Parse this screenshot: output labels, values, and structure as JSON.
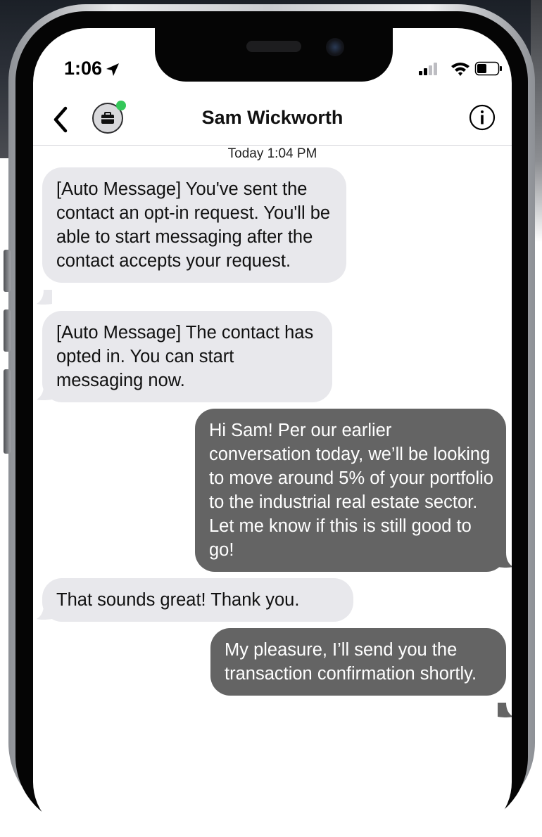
{
  "status_bar": {
    "time": "1:06"
  },
  "header": {
    "title": "Sam Wickworth",
    "back_icon": "chevron-left-icon",
    "avatar_icon": "briefcase-icon",
    "info_icon": "info-circle-icon",
    "presence_color": "#34c759"
  },
  "thread": {
    "timestamp": "Today 1:04 PM",
    "messages": [
      {
        "direction": "incoming",
        "text": "[Auto Message] You've sent the contact an opt-in request. You'll be able to start messaging after the contact accepts your request."
      },
      {
        "direction": "incoming",
        "text": "[Auto Message] The contact has opted in. You can start messaging now."
      },
      {
        "direction": "outgoing",
        "text": "Hi Sam! Per our earlier conversation today, we’ll be looking to move around 5% of your portfolio to the industrial real estate sector. Let me know if this is still good to go!"
      },
      {
        "direction": "incoming",
        "text": "That sounds great! Thank you."
      },
      {
        "direction": "outgoing",
        "text": "My pleasure, I’ll send you the transaction confirmation shortly."
      }
    ]
  },
  "colors": {
    "incoming_bubble": "#e8e8ec",
    "outgoing_bubble": "#646464",
    "outgoing_text": "#ffffff"
  }
}
